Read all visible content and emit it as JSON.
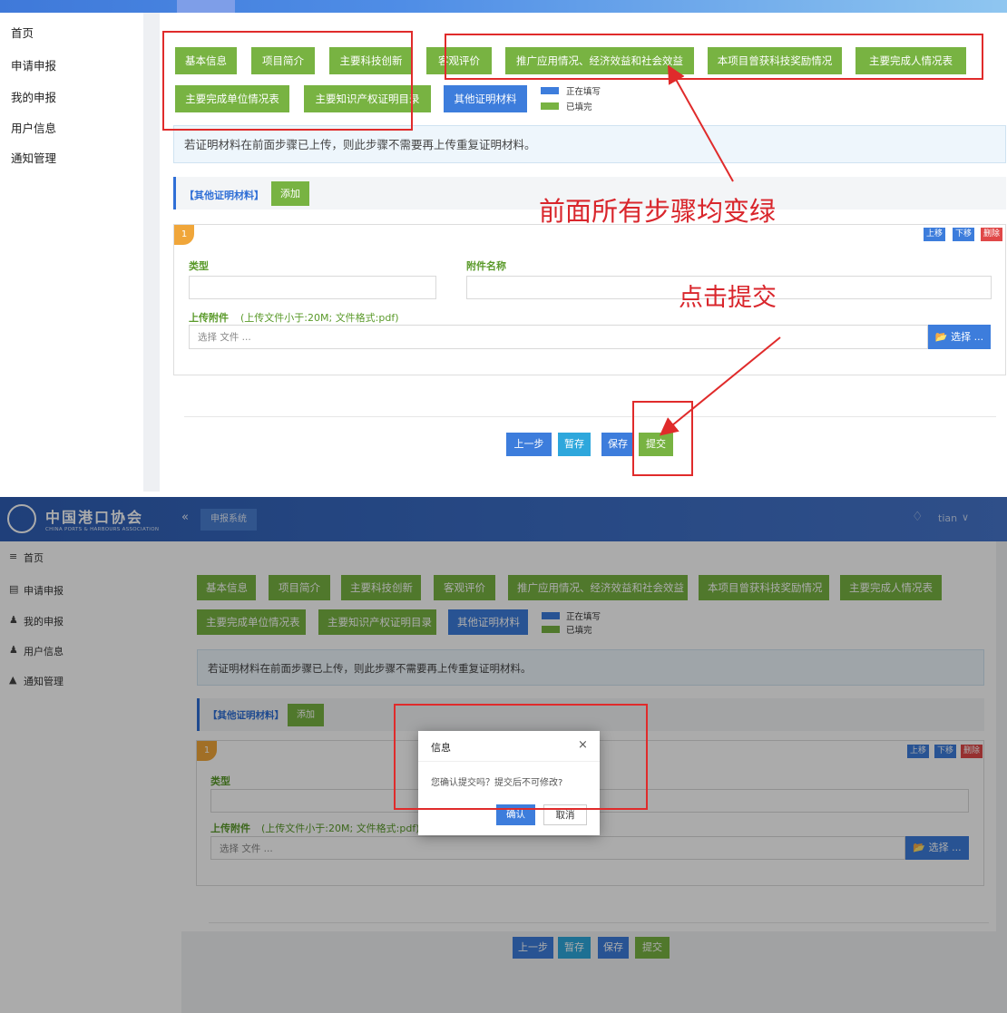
{
  "sidebar": {
    "items": [
      {
        "label": "首页",
        "icon": "menu-icon"
      },
      {
        "label": "申请申报",
        "icon": "form-icon"
      },
      {
        "label": "我的申报",
        "icon": "users-icon"
      },
      {
        "label": "用户信息",
        "icon": "users-icon"
      },
      {
        "label": "通知管理",
        "icon": "bell-icon"
      }
    ]
  },
  "header": {
    "org_name": "中国港口协会",
    "org_name_en": "CHINA PORTS & HARBOURS ASSOCIATION",
    "collapse_glyph": "«",
    "active_tab": "申报系统",
    "user": "tian",
    "bell_icon": "bell-icon",
    "dropdown_glyph": "∨"
  },
  "steps": {
    "tabs": [
      "基本信息",
      "项目简介",
      "主要科技创新",
      "客观评价",
      "推广应用情况、经济效益和社会效益",
      "本项目曾获科技奖励情况",
      "主要完成人情况表",
      "主要完成单位情况表",
      "主要知识产权证明目录",
      "其他证明材料"
    ],
    "active_index": 9,
    "legend": {
      "filling": "正在填写",
      "done": "已填完"
    }
  },
  "notice": "若证明材料在前面步骤已上传，则此步骤不需要再上传重复证明材料。",
  "section": {
    "title": "【其他证明材料】",
    "add_label": "添加"
  },
  "card": {
    "badge": "1",
    "move_up": "上移",
    "move_down": "下移",
    "delete": "删除",
    "type_label": "类型",
    "attachment_name_label": "附件名称",
    "upload_label": "上传附件",
    "upload_hint": "(上传文件小于:20M;   文件格式:pdf)",
    "file_placeholder": "选择 文件 ...",
    "pick_label": "选择 ..."
  },
  "actions": {
    "prev": "上一步",
    "draft": "暂存",
    "save": "保存",
    "submit": "提交"
  },
  "annotations": {
    "all_green": "前面所有步骤均变绿",
    "click_submit": "点击提交"
  },
  "dialog": {
    "title": "信息",
    "close": "×",
    "message": "您确认提交吗？提交后不可修改?",
    "confirm": "确认",
    "cancel": "取消"
  },
  "colors": {
    "step_done": "#78b342",
    "step_active": "#3d7ddc",
    "annotation": "#d9262c",
    "danger": "#e04848"
  }
}
